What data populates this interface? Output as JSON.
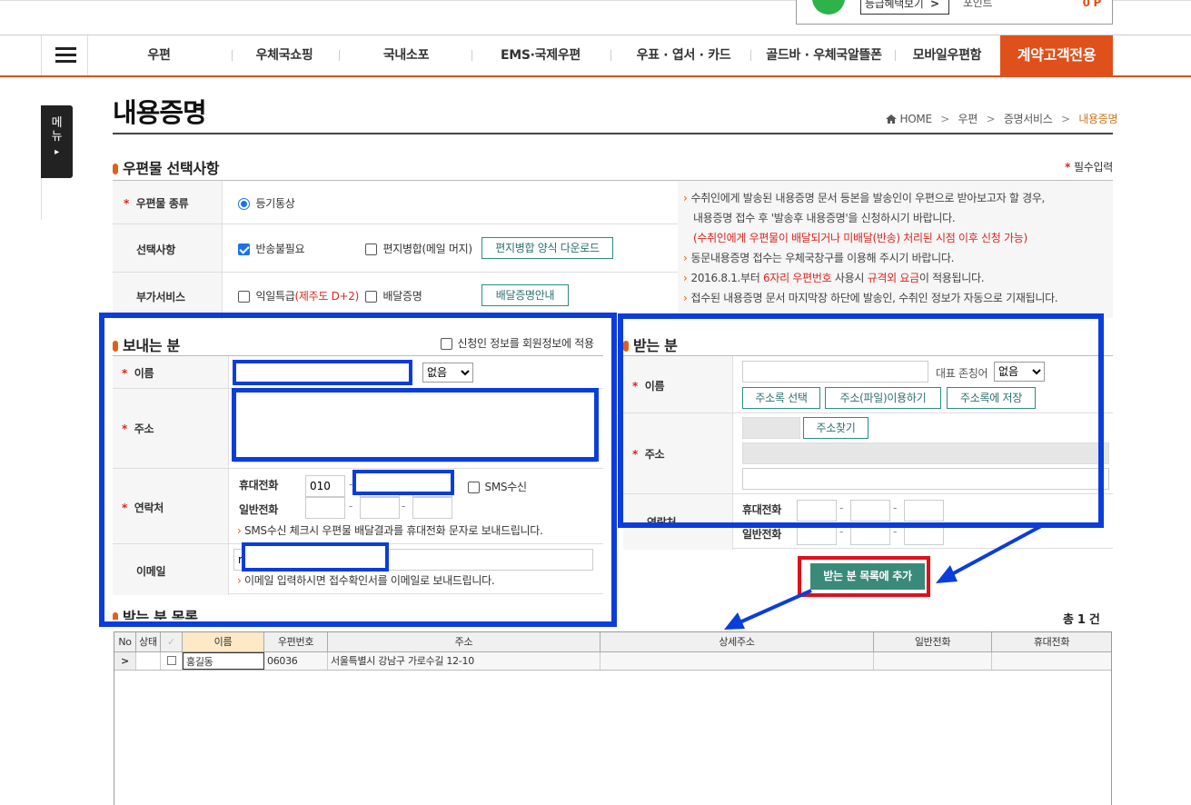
{
  "header": {
    "benefit_link": "등급혜택보기",
    "benefit_arrow": ">",
    "points_label": "포인트",
    "points_value": "0 P"
  },
  "nav": {
    "items": [
      "우편",
      "우체국쇼핑",
      "국내소포",
      "EMS·국제우편",
      "우표 · 엽서 · 카드",
      "골드바 · 우체국알뜰폰",
      "모바일우편함"
    ],
    "highlight": "계약고객전용",
    "accent_color": "#e0501a"
  },
  "side_menu": {
    "label1": "메",
    "label2": "뉴",
    "arrow": "▸"
  },
  "page": {
    "title": "내용증명",
    "breadcrumb": [
      "HOME",
      "우편",
      "증명서비스",
      "내용증명"
    ],
    "breadcrumb_sep": ">"
  },
  "section1": {
    "title": "우편물 선택사항",
    "required_note": "필수입력",
    "mail_type_label": "우편물 종류",
    "mail_type_value": "등기통상",
    "options_label": "선택사항",
    "opt_no_return": "반송불필요",
    "opt_merge": "편지병합(메일 머지)",
    "merge_download_btn": "편지병합 양식 다운로드",
    "extra_label": "부가서비스",
    "extra_next_day": "익일특급",
    "extra_jeju": "(제주도 D+2)",
    "extra_delivery_cert": "배달증명",
    "delivery_guide_btn": "배달증명안내",
    "notes": [
      {
        "text": "수취인에게 발송된 내용증명 문서 등본을 발송인이 우편으로 받아보고자 할 경우,",
        "bullet": true
      },
      {
        "text": "내용증명 접수 후 '발송후 내용증명'을 신청하시기 바랍니다.",
        "bullet": false
      },
      {
        "text": "(수취인에게 우편물이 배달되거나 미배달(반송) 처리된 시점 이후 신청 가능)",
        "bullet": false,
        "red": true
      },
      {
        "text": "동문내용증명 접수는 우체국창구를 이용해 주시기 바랍니다.",
        "bullet": true
      }
    ],
    "note5_a": "2016.8.1.부터 ",
    "note5_b": "6자리 우편번호",
    "note5_c": " 사용시 ",
    "note5_d": "규격외 요금",
    "note5_e": "이 적용됩니다.",
    "note6": "접수된 내용증명 문서 마지막장 하단에 발송인, 수취인 정보가 자동으로 기재됩니다."
  },
  "sender": {
    "title": "보내는 분",
    "apply_member": "신청인 정보를 회원정보에 적용",
    "name_label": "이름",
    "honorific": "없음",
    "address_label": "주소",
    "contact_label": "연락처",
    "mobile_label": "휴대전화",
    "mobile_prefix": "010",
    "dash": "-",
    "sms_label": "SMS수신",
    "phone_label": "일반전화",
    "sms_note": "SMS수신 체크시 우편물 배달결과를 휴대전화 문자로 보내드립니다.",
    "email_label": "이메일",
    "email_value": "m",
    "email_note": "이메일 입력하시면 접수확인서를 이메일로 보내드립니다."
  },
  "receiver": {
    "title": "받는 분",
    "name_label": "이름",
    "rep_honorific_label": "대표 존칭어",
    "honorific": "없음",
    "btn_addrbook": "주소록 선택",
    "btn_file": "주소(파일)이용하기",
    "btn_save": "주소록에 저장",
    "address_label": "주소",
    "btn_find": "주소찾기",
    "contact_label": "연락처",
    "mobile_label": "휴대전화",
    "phone_label": "일반전화",
    "dash": "-",
    "add_btn": "받는 분 목록에 추가"
  },
  "list": {
    "title": "받는 분 목록",
    "count": "총 1 건",
    "columns": [
      "No",
      "상태",
      "✓",
      "이름",
      "우편번호",
      "주소",
      "상세주소",
      "일반전화",
      "휴대전화"
    ],
    "rows": [
      {
        "no": ">",
        "status": "",
        "check": "",
        "name": "홍길동",
        "zip": "06036",
        "addr": "서울특별시 강남구 가로수길 12-10",
        "detail": "",
        "phone": "",
        "mobile": ""
      }
    ]
  }
}
